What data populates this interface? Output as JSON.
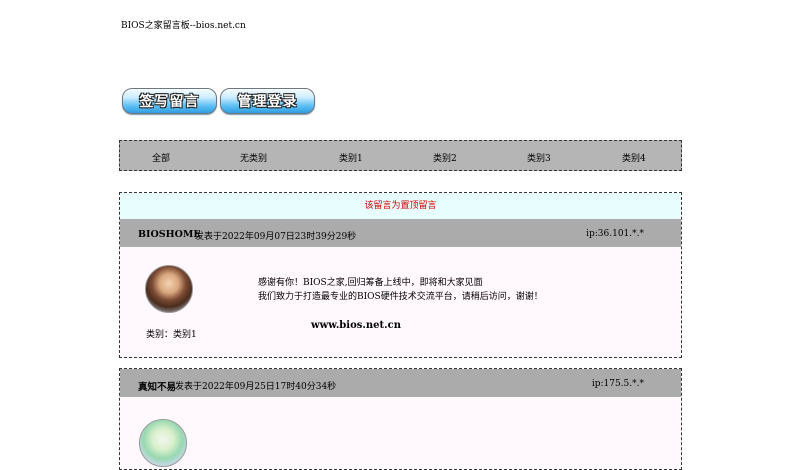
{
  "site_title": "BIOS之家留言板--bios.net.cn",
  "buttons": {
    "sign": "签写留言",
    "admin": "管理登录"
  },
  "categories": [
    "全部",
    "无类别",
    "类别1",
    "类别2",
    "类别3",
    "类别4"
  ],
  "posts": [
    {
      "pin_notice": "该留言为置顶留言",
      "author": "BIOSHOME",
      "date": "发表于2022年09月07日23时39分29秒",
      "ip": "ip:36.101.*.*",
      "category": "类别：类别1",
      "message_lines": [
        "感谢有你！BIOS之家,回归筹备上线中，即将和大家见面",
        "我们致力于打造最专业的BIOS硬件技术交流平台，请稍后访问，谢谢！"
      ],
      "url": "www.bios.net.cn"
    },
    {
      "author": "真知不易",
      "date": "发表于2022年09月25日17时40分34秒",
      "ip": "ip:175.5.*.*"
    }
  ],
  "colors": {
    "category_bar": "#b5b5b5",
    "post_header": "#ababab",
    "post_body": "#fff8fd",
    "pin_bg": "#e8fdfd",
    "pin_text": "#d00000"
  },
  "icons": [
    "avatar-icon"
  ]
}
